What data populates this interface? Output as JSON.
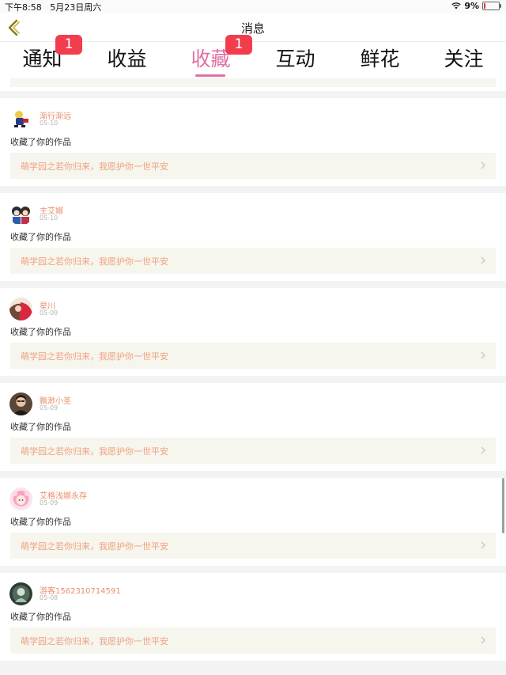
{
  "status": {
    "time": "下午8:58",
    "date": "5月23日周六",
    "battery": "9%"
  },
  "nav": {
    "title": "消息"
  },
  "tabs": [
    {
      "label": "通知",
      "badge": "1",
      "active": false
    },
    {
      "label": "收益",
      "badge": "",
      "active": false
    },
    {
      "label": "收藏",
      "badge": "1",
      "active": true
    },
    {
      "label": "互动",
      "badge": "",
      "active": false
    },
    {
      "label": "鲜花",
      "badge": "",
      "active": false
    },
    {
      "label": "关注",
      "badge": "",
      "active": false
    }
  ],
  "items": [
    {
      "username": "渐行渐远",
      "date": "05-10",
      "action": "收藏了你的作品",
      "work": "萌学园之若你归来，我愿护你一世平安"
    },
    {
      "username": "主艾娜",
      "date": "05-10",
      "action": "收藏了你的作品",
      "work": "萌学园之若你归来，我愿护你一世平安"
    },
    {
      "username": "星川",
      "date": "05-09",
      "action": "收藏了你的作品",
      "work": "萌学园之若你归来，我愿护你一世平安"
    },
    {
      "username": "飘渺小圣",
      "date": "05-09",
      "action": "收藏了你的作品",
      "work": "萌学园之若你归来，我愿护你一世平安"
    },
    {
      "username": "艾格浅娜永存",
      "date": "05-09",
      "action": "收藏了你的作品",
      "work": "萌学园之若你归来，我愿护你一世平安"
    },
    {
      "username": "游客1562310714591",
      "date": "05-08",
      "action": "收藏了你的作品",
      "work": "萌学园之若你归来，我愿护你一世平安"
    }
  ],
  "colors": {
    "accent": "#e070a4",
    "badge": "#f23d4f",
    "username": "#e8906f",
    "work_title": "#f0a27e",
    "work_bg": "#f6f5ee"
  },
  "icons": {
    "back": "chevron-left-icon",
    "wifi": "wifi-icon",
    "battery": "battery-icon",
    "chevron": "chevron-right-icon"
  }
}
